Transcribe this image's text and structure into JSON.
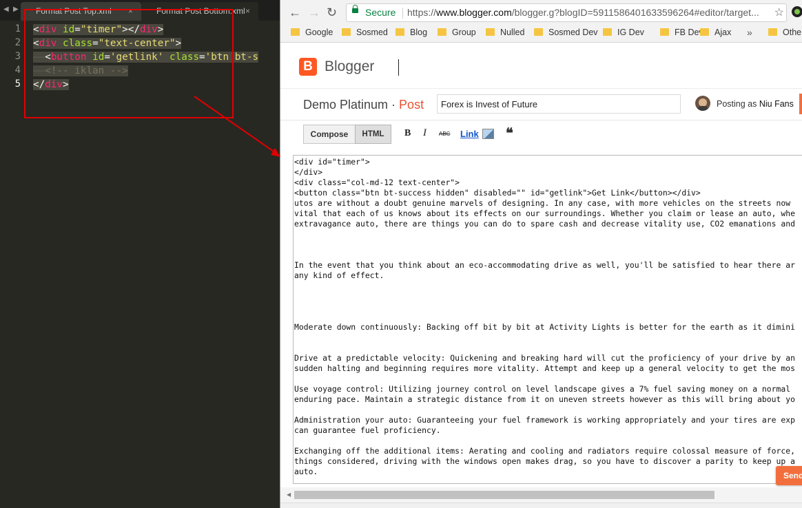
{
  "editor": {
    "tabs": [
      {
        "label": "Format Post Top.xml",
        "close": "×"
      },
      {
        "label": "Format Post Bottom.xml",
        "close": "×"
      }
    ],
    "nav": {
      "back": "◀",
      "forward": "▶"
    },
    "line_numbers": [
      "1",
      "2",
      "3",
      "4",
      "5"
    ]
  },
  "browser": {
    "secure_label": "Secure",
    "url_scheme": "https://",
    "url_domain": "www.blogger.com",
    "url_path": "/blogger.g?blogID=5911586401633596264#editor/target...",
    "bookmarks": [
      "Google",
      "Sosmed",
      "Blog",
      "Group",
      "Nulled",
      "Sosmed Dev",
      "IG Dev",
      "FB Dev",
      "Ajax",
      "Other"
    ],
    "more_bookmarks": "»"
  },
  "blogger": {
    "logo_letter": "B",
    "brand": "Blogger",
    "blog_name": "Demo Platinum",
    "separator": " · ",
    "post_label": "Post",
    "post_title": "Forex is Invest of Future",
    "posting_as_label": "Posting as",
    "user_name": "Niu Fans",
    "modes": {
      "compose": "Compose",
      "html": "HTML"
    },
    "format": {
      "bold": "B",
      "italic": "I",
      "strike": "ABC",
      "link": "Link",
      "quote": "❝"
    },
    "html_lines": [
      "<div id=\"timer\">",
      "</div>",
      "<div class=\"col-md-12 text-center\">",
      "<button class=\"btn bt-success hidden\" disabled=\"\" id=\"getlink\">Get Link</button></div>",
      "utos are without a doubt genuine marvels of designing. In any case, with more vehicles on the streets now",
      "vital that each of us knows about its effects on our surroundings. Whether you claim or lease an auto, whe",
      "extravagance auto, there are things you can do to spare cash and decrease vitality use, CO2 emanations and",
      "",
      "",
      "",
      "In the event that you think about an eco-accommodating drive as well, you'll be satisfied to hear there ar",
      "any kind of effect.",
      "",
      "",
      "",
      "",
      "Moderate down continuously: Backing off bit by bit at Activity Lights is better for the earth as it dimini",
      "",
      "",
      "Drive at a predictable velocity: Quickening and breaking hard will cut the proficiency of your drive by an",
      "sudden halting and beginning requires more vitality. Attempt and keep up a general velocity to get the mos",
      "",
      "Use voyage control: Utilizing journey control on level landscape gives a 7% fuel saving money on a normal",
      "enduring pace. Maintain a strategic distance from it on uneven streets however as this will bring about yo",
      "",
      "Administration your auto: Guaranteeing your fuel framework is working appropriately and your tires are exp",
      "can guarantee fuel proficiency.",
      "",
      "Exchanging off the additional items: Aerating and cooling and radiators require colossal measure of force,",
      "things considered, driving with the windows open makes drag, so you have to discover a parity to keep up a",
      "auto."
    ],
    "send_label": "Send"
  }
}
